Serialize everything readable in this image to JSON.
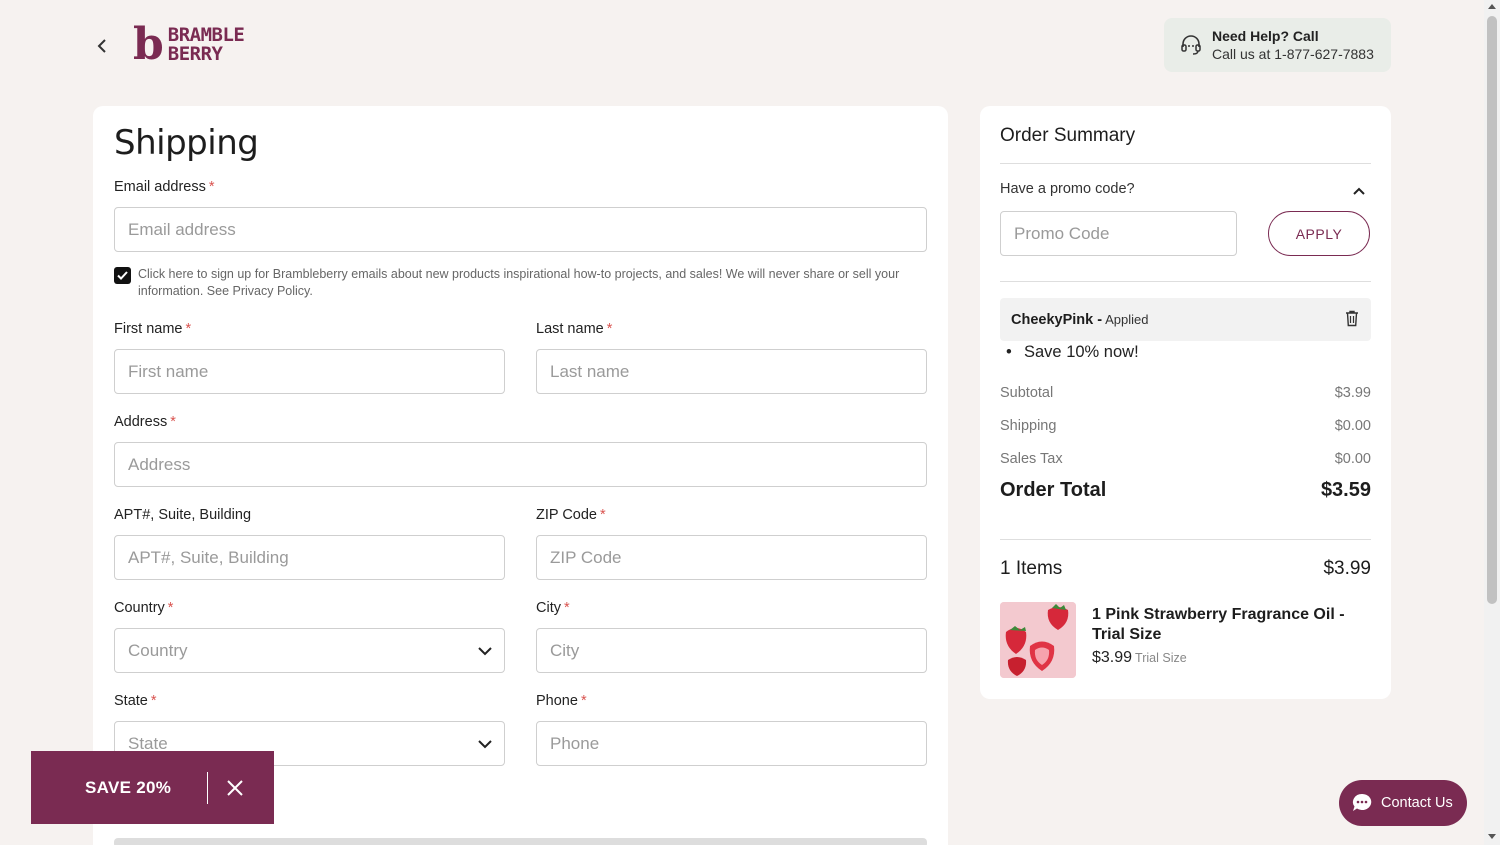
{
  "header": {
    "logo_line1": "BRAMBLE",
    "logo_line2": "BERRY",
    "logo_mark": "b",
    "help_title": "Need Help? Call",
    "help_phone": "Call us at 1-877-627-7883"
  },
  "shipping": {
    "title": "Shipping",
    "required_mark": "*",
    "email": {
      "label": "Email address",
      "placeholder": "Email address"
    },
    "signup_text": "Click here to sign up for Brambleberry emails about new products inspirational how-to projects, and sales! We will never share or sell your information. See Privacy Policy.",
    "first_name": {
      "label": "First name",
      "placeholder": "First name"
    },
    "last_name": {
      "label": "Last name",
      "placeholder": "Last name"
    },
    "address": {
      "label": "Address",
      "placeholder": "Address"
    },
    "apt": {
      "label": "APT#, Suite, Building",
      "placeholder": "APT#, Suite, Building"
    },
    "zip": {
      "label": "ZIP Code",
      "placeholder": "ZIP Code"
    },
    "country": {
      "label": "Country",
      "placeholder": "Country"
    },
    "city": {
      "label": "City",
      "placeholder": "City"
    },
    "state": {
      "label": "State",
      "placeholder": "State"
    },
    "phone": {
      "label": "Phone",
      "placeholder": "Phone"
    },
    "signup_checked": true
  },
  "summary": {
    "title": "Order Summary",
    "promo_question": "Have a promo code?",
    "promo_placeholder": "Promo Code",
    "apply_label": "APPLY",
    "applied_code": "CheekyPink -",
    "applied_status": "Applied",
    "promo_description": "Save 10% now!",
    "subtotal_label": "Subtotal",
    "subtotal_value": "$3.99",
    "shipping_label": "Shipping",
    "shipping_value": "$0.00",
    "tax_label": "Sales Tax",
    "tax_value": "$0.00",
    "total_label": "Order Total",
    "total_value": "$3.59",
    "items_label": "1 Items",
    "items_value": "$3.99",
    "product": {
      "name": "1 Pink Strawberry Fragrance Oil - Trial Size",
      "price": "$3.99",
      "size": "Trial Size"
    }
  },
  "promo_banner": {
    "label": "SAVE 20%"
  },
  "contact": {
    "label": "Contact Us"
  },
  "colors": {
    "brand": "#7a2b52",
    "background": "#f6f2f0",
    "help_bg": "#e9ede8",
    "required": "#d9534f"
  }
}
